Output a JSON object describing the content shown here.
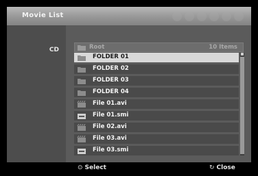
{
  "window": {
    "title": "Movie List"
  },
  "sidebar": {
    "source_label": "CD"
  },
  "list": {
    "root_label": "Root",
    "item_count": "10 Items",
    "items": [
      {
        "label": "FOLDER 01",
        "icon": "folder-icon",
        "selected": true
      },
      {
        "label": "FOLDER 02",
        "icon": "folder-icon"
      },
      {
        "label": "FOLDER 03",
        "icon": "folder-icon"
      },
      {
        "label": "FOLDER 04",
        "icon": "folder-icon"
      },
      {
        "label": "File 01.avi",
        "icon": "movie-file-icon"
      },
      {
        "label": "File 01.smi",
        "icon": "subtitle-file-icon"
      },
      {
        "label": "File 02.avi",
        "icon": "movie-file-icon"
      },
      {
        "label": "File 03.avi",
        "icon": "movie-file-icon"
      },
      {
        "label": "File 03.smi",
        "icon": "subtitle-file-icon"
      }
    ]
  },
  "footer": {
    "select_icon": "⊙",
    "select_label": "Select",
    "close_icon": "↻",
    "close_label": "Close"
  },
  "colors": {
    "highlight": "#d9d9d9",
    "row": "#4a4a4a",
    "panel": "#5b5b5b"
  }
}
